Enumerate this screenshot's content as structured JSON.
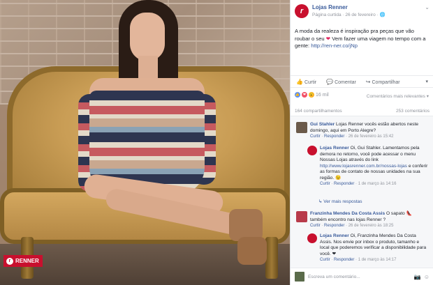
{
  "page": {
    "name": "Lojas Renner",
    "meta": "Página curtida · 26 de fevereiro · 🌐",
    "post_text_1": "A moda da realeza é inspiração pra peças que vão roubar o seu",
    "post_text_2": "Vem fazer uma viagem no tempo com a gente:",
    "post_link": "http://ren-ner.co/jNp",
    "badge": "RENNER"
  },
  "actions": {
    "like": "Curtir",
    "comment": "Comentar",
    "share": "Compartilhar"
  },
  "reactions": {
    "count": "16 mil",
    "sort": "Comentários mais relevantes ▾",
    "shares": "164 compartilhamentos",
    "comments": "253 comentários"
  },
  "comments": [
    {
      "name": "Gui Stahler",
      "text": "Lojas Renner vocês estão abertos neste domingo, aqui em Porto Alegre?",
      "like": "Curtir",
      "reply": "Responder",
      "time": "26 de fevereiro às 15:42"
    },
    {
      "name": "Lojas Renner",
      "text1": "Oi, Gui Stahler. Lamentamos pela demora no retorno, você pode acessar o menu Nossas Lojas através do link",
      "text2": "http://www.lojasrenner.com.br/nossas-lojas",
      "text3": "e conferir as formas de contato de nossas unidades na sua região. 😉",
      "like": "Curtir",
      "reply": "Responder",
      "time": "1 de março às 14:16"
    },
    {
      "name": "Franzinha Mendes Da Costa Assis",
      "text": "O sapato 👠 também encontro nas lojas Renner ?",
      "like": "Curtir",
      "reply": "Responder",
      "time": "26 de fevereiro às 18:25"
    },
    {
      "name": "Lojas Renner",
      "text": "Oi, Franzinha Mendes Da Costa Assis. Nos envie por inbox o produto, tamanho e local que poderemos verificar a disponibilidade para você. ❤",
      "like": "Curtir",
      "reply": "Responder",
      "time": "1 de março às 14:17"
    }
  ],
  "more_replies": "↳ Ver mais respostas",
  "write_placeholder": "Escreva um comentário...",
  "colors": {
    "brand": "#c8102e",
    "link": "#365899",
    "meta": "#90949c"
  }
}
